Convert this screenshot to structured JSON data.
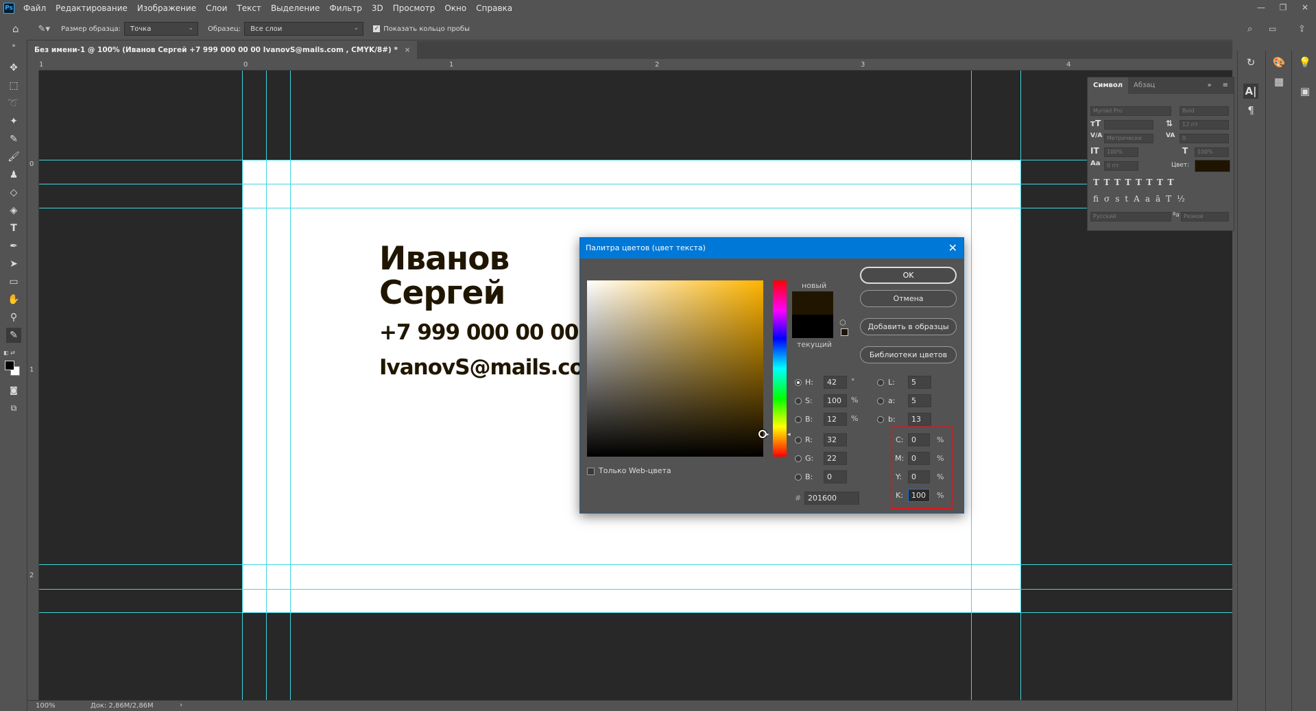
{
  "app": {
    "logo": "Ps"
  },
  "menu": [
    "Файл",
    "Редактирование",
    "Изображение",
    "Слои",
    "Текст",
    "Выделение",
    "Фильтр",
    "3D",
    "Просмотр",
    "Окно",
    "Справка"
  ],
  "window_controls": {
    "minimize": "—",
    "restore": "❐",
    "close": "✕"
  },
  "options_bar": {
    "sample_size_label": "Размер образца:",
    "sample_size_value": "Точка",
    "sample_label": "Образец:",
    "sample_value": "Все слои",
    "show_ring_label": "Показать кольцо пробы",
    "show_ring_checked": true
  },
  "document_tab": {
    "title": "Без имени-1 @ 100% (Иванов Сергей +7 999 000 00 00  IvanovS@mails.com , CMYK/8#) *",
    "close": "×"
  },
  "rulers": {
    "h_ticks": [
      "1",
      "0",
      "1",
      "2",
      "3",
      "4"
    ],
    "v_ticks": [
      "0",
      "1",
      "2"
    ]
  },
  "card": {
    "name_line1": "Иванов",
    "name_line2": "Сергей",
    "phone": "+7 999 000 00 00",
    "email": "IvanovS@mails.com",
    "text_color": "#201600"
  },
  "status": {
    "zoom": "100%",
    "doc": "Док: 2,86M/2,86M",
    "arrow": "›"
  },
  "char_panel": {
    "tab_active": "Символ",
    "tab_other": "Абзац",
    "font_family": "Myriad Pro",
    "font_style": "Bold",
    "leading": "12 пт",
    "kerning": "Метрически",
    "tracking": "0",
    "vscale": "100%",
    "hscale": "100%",
    "baseline": "0 пт",
    "color_label": "Цвет:",
    "color_value": "#1e1400",
    "language": "Русский",
    "antialias": "Резкое",
    "aa_glyph": "ªa"
  },
  "dialog": {
    "title": "Палитра цветов (цвет текста)",
    "close": "✕",
    "new_label": "новый",
    "current_label": "текущий",
    "new_color": "#201600",
    "current_color": "#000000",
    "web_only_label": "Только Web-цвета",
    "buttons": {
      "ok": "OK",
      "cancel": "Отмена",
      "add_swatch": "Добавить в образцы",
      "libraries": "Библиотеки цветов"
    },
    "hsb": {
      "H": "42",
      "S": "100",
      "B": "12"
    },
    "hsb_units": {
      "H": "°",
      "S": "%",
      "B": "%"
    },
    "lab": {
      "L": "5",
      "a": "5",
      "b": "13"
    },
    "rgb": {
      "R": "32",
      "G": "22",
      "B": "0"
    },
    "cmyk": {
      "C": "0",
      "M": "0",
      "Y": "0",
      "K": "100"
    },
    "hex": "201600",
    "labels": {
      "H": "H:",
      "S": "S:",
      "B": "B:",
      "L": "L:",
      "a": "a:",
      "b": "b:",
      "R": "R:",
      "G": "G:",
      "Bl": "B:",
      "C": "C:",
      "M": "M:",
      "Y": "Y:",
      "K": "K:",
      "hash": "#",
      "pct": "%"
    }
  }
}
